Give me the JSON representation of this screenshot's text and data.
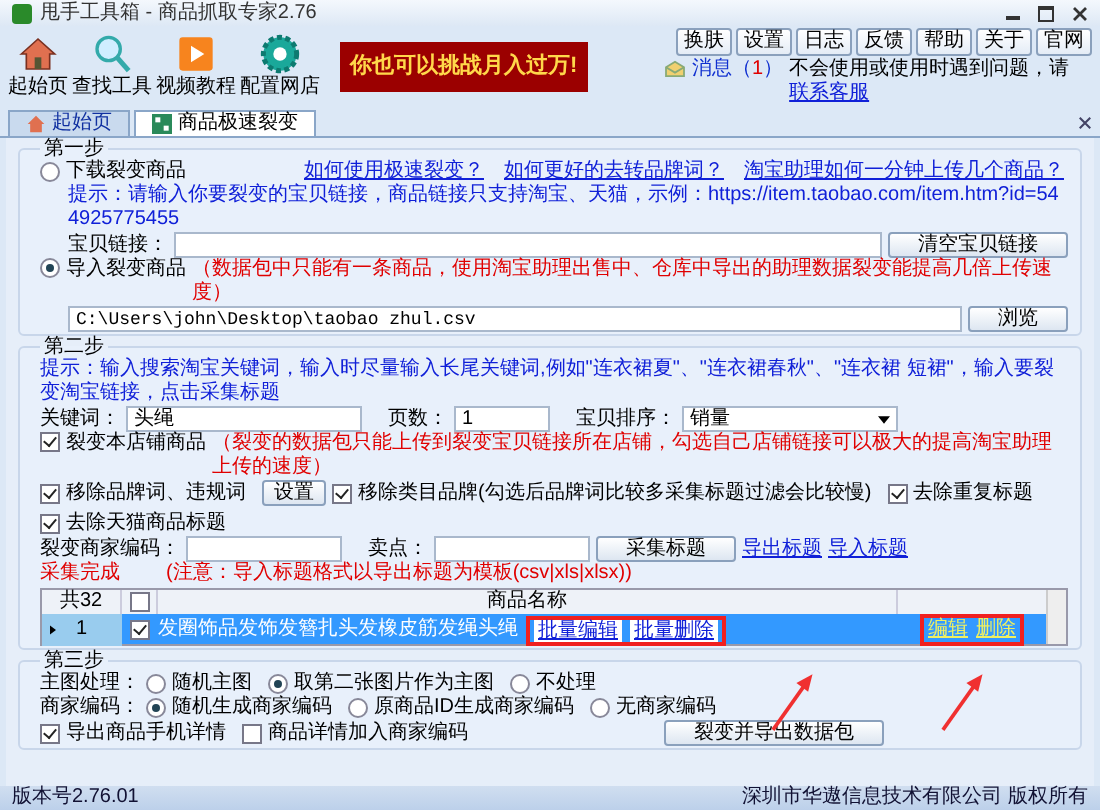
{
  "window": {
    "title": "甩手工具箱 - 商品抓取专家2.76"
  },
  "toolbar": [
    {
      "label": "起始页",
      "kind": "house"
    },
    {
      "label": "查找工具",
      "kind": "search"
    },
    {
      "label": "视频教程",
      "kind": "play"
    },
    {
      "label": "配置网店",
      "kind": "gear"
    }
  ],
  "banner": "你也可以挑战月入过万!",
  "top_buttons": [
    "换肤",
    "设置",
    "日志",
    "反馈",
    "帮助",
    "关于",
    "官网"
  ],
  "message": {
    "label": "消息（",
    "count": "1",
    "suffix": "）"
  },
  "help": {
    "text": "不会使用或使用时遇到问题，请",
    "link": "联系客服"
  },
  "tabs": [
    {
      "label": "起始页",
      "selected": false,
      "kind": "house"
    },
    {
      "label": "商品极速裂变",
      "selected": true,
      "kind": "grid"
    }
  ],
  "step1": {
    "title": "第一步",
    "links": [
      "如何使用极速裂变？",
      "如何更好的去转品牌词？",
      "淘宝助理如何一分钟上传几个商品？"
    ],
    "options": [
      {
        "label": "下载裂变商品",
        "selected": false
      },
      {
        "label": "导入裂变商品",
        "selected": true
      }
    ],
    "hint": "提示：请输入你要裂变的宝贝链接，商品链接只支持淘宝、天猫，示例：https://item.taobao.com/item.htm?id=544925775455",
    "url_label": "宝贝链接：",
    "clear_button": "清空宝贝链接",
    "import_note": "（数据包中只能有一条商品，使用淘宝助理出售中、仓库中导出的助理数据裂变能提高几倍上传速度）",
    "path": "C:\\Users\\john\\Desktop\\taobao zhul.csv",
    "browse_button": "浏览"
  },
  "step2": {
    "title": "第二步",
    "hint": "提示：输入搜索淘宝关键词，输入时尽量输入长尾关键词,例如\"连衣裙夏\"、\"连衣裙春秋\"、\"连衣裙 短裙\"，输入要裂变淘宝链接，点击采集标题",
    "keyword_label": "关键词：",
    "keyword": "头绳",
    "pages_label": "页数：",
    "pages": "1",
    "sort_label": "宝贝排序：",
    "sort": "销量",
    "shop_check": {
      "label": "裂变本店铺商品",
      "checked": true
    },
    "shop_note": "（裂变的数据包只能上传到裂变宝贝链接所在店铺，勾选自己店铺链接可以极大的提高淘宝助理上传的速度）",
    "filters": [
      {
        "label": "移除品牌词、违规词",
        "checked": true
      },
      {
        "label": "移除类目品牌(勾选后品牌词比较多采集标题过滤会比较慢)",
        "checked": true
      },
      {
        "label": "去除重复标题",
        "checked": true
      },
      {
        "label": "去除天猫商品标题",
        "checked": true
      }
    ],
    "settings_button": "设置",
    "code_label": "裂变商家编码：",
    "selling_label": "卖点：",
    "collect_button": "采集标题",
    "export_link": "导出标题",
    "import_link": "导入标题",
    "note": "(注意：导入标题格式以导出标题为模板(csv|xls|xlsx))",
    "status": "采集完成",
    "table": {
      "count": "共32",
      "all_checked": false,
      "name_column": "商品名称",
      "batch_buttons": [
        "批量编辑",
        "批量删除"
      ],
      "rows": [
        {
          "index": "1",
          "checked": true,
          "selected": true,
          "name": "发圈饰品发饰发簪扎头发橡皮筋发绳头绳",
          "edit": "编辑",
          "delete": "删除"
        }
      ]
    }
  },
  "step3": {
    "title": "第三步",
    "main_image": {
      "label": "主图处理：",
      "options": [
        {
          "label": "随机主图",
          "selected": false
        },
        {
          "label": "取第二张图片作为主图",
          "selected": true
        },
        {
          "label": "不处理",
          "selected": false
        }
      ]
    },
    "merchant_code": {
      "label": "商家编码：",
      "options": [
        {
          "label": "随机生成商家编码",
          "selected": true
        },
        {
          "label": "原商品ID生成商家编码",
          "selected": false
        },
        {
          "label": "无商家编码",
          "selected": false
        }
      ]
    },
    "checks": [
      {
        "label": "导出商品手机详情",
        "checked": true
      },
      {
        "label": "商品详情加入商家编码",
        "checked": false
      }
    ],
    "export_button": "裂变并导出数据包"
  },
  "status_bar": {
    "version": "版本号2.76.01",
    "copyright": "深圳市华遨信息技术有限公司 版权所有"
  }
}
